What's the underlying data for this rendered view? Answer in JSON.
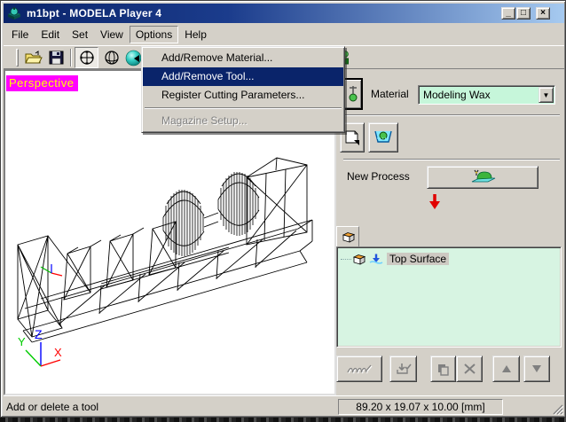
{
  "window": {
    "title": "m1bpt - MODELA Player 4",
    "controls": {
      "minimize": "_",
      "maximize": "□",
      "close": "×"
    }
  },
  "menubar": {
    "items": [
      {
        "label": "File"
      },
      {
        "label": "Edit"
      },
      {
        "label": "Set"
      },
      {
        "label": "View"
      },
      {
        "label": "Options",
        "state": "open"
      },
      {
        "label": "Help"
      }
    ]
  },
  "options_menu": {
    "items": [
      {
        "label": "Add/Remove Material...",
        "state": "normal"
      },
      {
        "label": "Add/Remove Tool...",
        "state": "highlighted"
      },
      {
        "label": "Register Cutting Parameters...",
        "state": "normal"
      },
      {
        "label": "Magazine Setup...",
        "state": "disabled"
      }
    ]
  },
  "toolbar": {
    "icons": [
      "open-file-icon",
      "save-icon",
      "pan-view-icon",
      "rotate-view-icon",
      "shaded-view-icon",
      "material-block-icon"
    ]
  },
  "viewport": {
    "view_label": "Perspective",
    "axes": {
      "x": "X",
      "y": "Y",
      "z": "Z"
    }
  },
  "panel": {
    "material_label": "Material",
    "material_value": "Modeling Wax",
    "combo_arrow": "▼",
    "new_process_label": "New Process",
    "tree": {
      "items": [
        {
          "label": "Top Surface"
        }
      ]
    }
  },
  "statusbar": {
    "message": "Add or delete a tool",
    "dimensions": "89.20 x 19.07 x 10.00 [mm]"
  },
  "colors": {
    "window_face": "#d4d0c8",
    "titlebar_left": "#0a246a",
    "titlebar_right": "#a6caf0",
    "menu_highlight": "#0a246a",
    "perspective_bg": "#ff00ff",
    "perspective_text": "#ffff00",
    "mint_field": "#c6f6da",
    "mint_tree": "#d7f4e2",
    "arrow_red": "#e10000"
  }
}
